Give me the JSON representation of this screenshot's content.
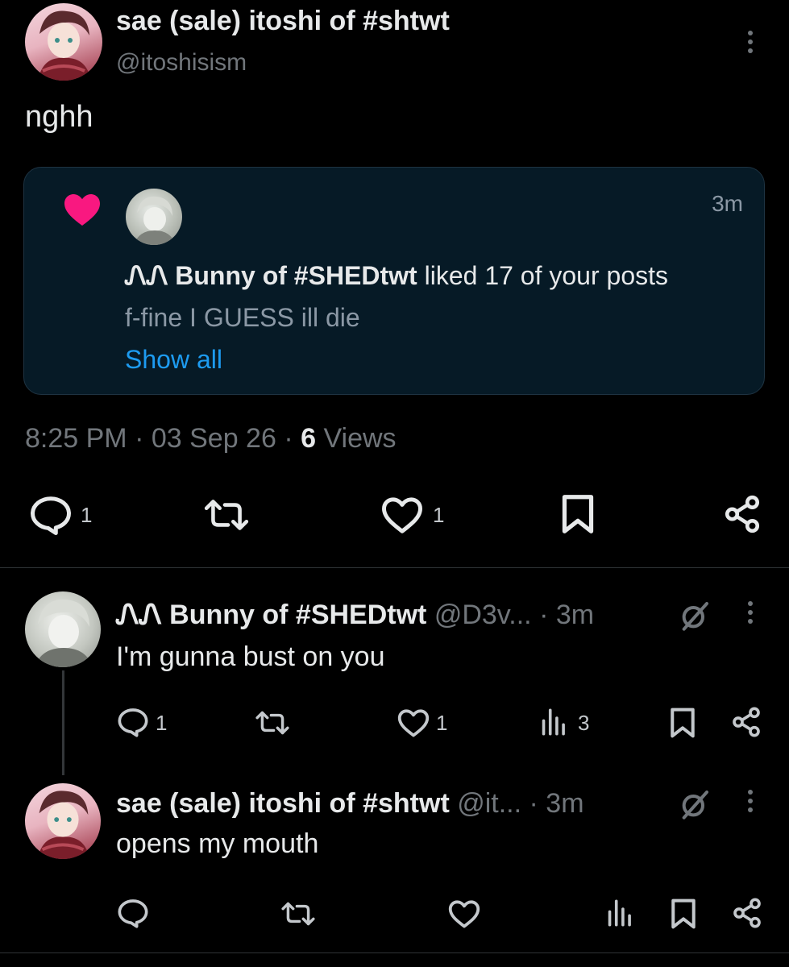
{
  "main_post": {
    "display_name": "sae (sale) itoshi of #shtwt",
    "handle": "@itoshisism",
    "text": "nghh",
    "notification_card": {
      "time": "3m",
      "actor_name": "ᏁᏁ Bunny of #SHEDtwt",
      "action_text": " liked 17 of your posts",
      "preview_text": "f-fine I GUESS ill die",
      "show_all": "Show all"
    },
    "meta": {
      "time": "8:25 PM",
      "sep1": " · ",
      "date": "03 Sep 26",
      "sep2": " · ",
      "views_count": "6",
      "views_label": " Views"
    },
    "actions": {
      "reply_count": "1",
      "like_count": "1"
    }
  },
  "replies": [
    {
      "display_name": "ᏁᏁ Bunny of #SHEDtwt",
      "handle": "@D3v...",
      "time": "· 3m",
      "text": "I'm gunna bust on you",
      "reply_count": "1",
      "like_count": "1",
      "views_count": "3"
    },
    {
      "display_name": "sae (sale) itoshi of #shtwt",
      "handle": "@it...",
      "time": "· 3m",
      "text": "opens my mouth"
    }
  ],
  "colors": {
    "background": "#000000",
    "text": "#e7e9ea",
    "muted": "#71767b",
    "link": "#1d9bf0",
    "heart": "#f91880",
    "card_bg": "#061a26"
  }
}
